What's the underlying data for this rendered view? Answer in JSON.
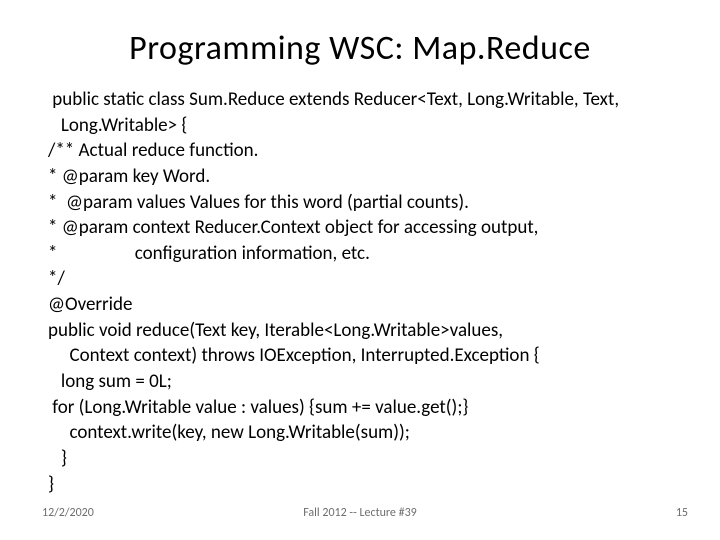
{
  "title": "Programming WSC: Map.Reduce",
  "code": {
    "l1": " public static class Sum.Reduce extends Reducer<Text, Long.Writable, Text,",
    "l2": "   Long.Writable> {",
    "l3": "/** Actual reduce function.",
    "l4": "* @param key Word.",
    "l5": "*  @param values Values for this word (partial counts).",
    "l6": "* @param context Reducer.Context object for accessing output,",
    "l7": "*                  configuration information, etc.",
    "l8": "*/",
    "l9": "@Override",
    "l10": "public void reduce(Text key, Iterable<Long.Writable>values,",
    "l11": "     Context context) throws IOException, Interrupted.Exception {",
    "l12": "   long sum = 0L;",
    "l13": " for (Long.Writable value : values) {sum += value.get();}",
    "l14": "     context.write(key, new Long.Writable(sum));",
    "l15": "   }",
    "l16": "}"
  },
  "footer": {
    "date": "12/2/2020",
    "center": "Fall 2012 -- Lecture #39",
    "number": "15"
  }
}
